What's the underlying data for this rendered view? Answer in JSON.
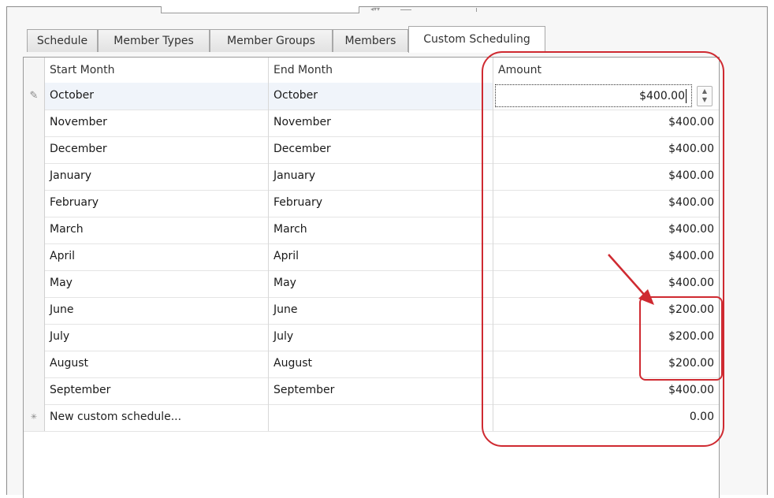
{
  "tabs": [
    {
      "label": "Schedule"
    },
    {
      "label": "Member Types"
    },
    {
      "label": "Member Groups"
    },
    {
      "label": "Members"
    },
    {
      "label": "Custom Scheduling",
      "active": true
    }
  ],
  "grid": {
    "columns": [
      "Start Month",
      "End Month",
      "Amount"
    ],
    "rows": [
      {
        "start": "October",
        "end": "October",
        "amount": "$400.00",
        "editing": true
      },
      {
        "start": "November",
        "end": "November",
        "amount": "$400.00"
      },
      {
        "start": "December",
        "end": "December",
        "amount": "$400.00"
      },
      {
        "start": "January",
        "end": "January",
        "amount": "$400.00"
      },
      {
        "start": "February",
        "end": "February",
        "amount": "$400.00"
      },
      {
        "start": "March",
        "end": "March",
        "amount": "$400.00"
      },
      {
        "start": "April",
        "end": "April",
        "amount": "$400.00"
      },
      {
        "start": "May",
        "end": "May",
        "amount": "$400.00"
      },
      {
        "start": "June",
        "end": "June",
        "amount": "$200.00"
      },
      {
        "start": "July",
        "end": "July",
        "amount": "$200.00"
      },
      {
        "start": "August",
        "end": "August",
        "amount": "$200.00"
      },
      {
        "start": "September",
        "end": "September",
        "amount": "$400.00"
      }
    ],
    "new_row": {
      "start": "New custom schedule...",
      "amount": "0.00"
    }
  },
  "icons": {
    "edit_indicator": "pencil-icon",
    "new_row_indicator": "asterisk-icon",
    "spinner": "spin-updown-icon"
  },
  "annotation_color": "#cf2a31"
}
